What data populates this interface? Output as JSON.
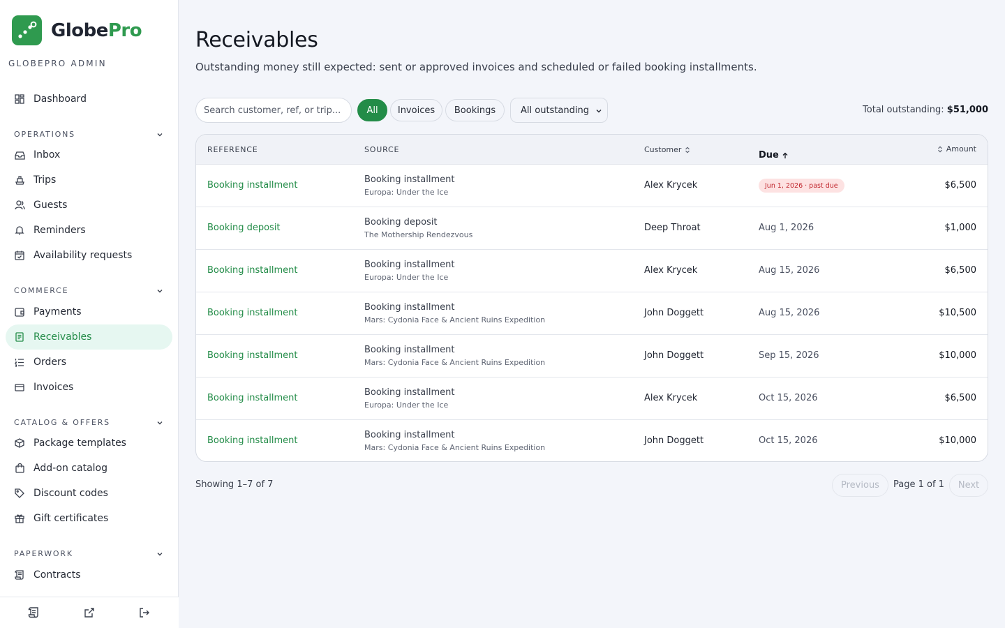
{
  "brand": {
    "name_main": "Globe",
    "name_accent": "Pro",
    "admin_label": "GLOBEPRO ADMIN",
    "color": "#2f9a4f"
  },
  "sidebar": {
    "dashboard": {
      "label": "Dashboard",
      "icon": "dashboard-icon"
    },
    "sections": {
      "operations": {
        "title": "OPERATIONS",
        "items": [
          {
            "label": "Inbox",
            "icon": "inbox-icon"
          },
          {
            "label": "Trips",
            "icon": "ship-icon"
          },
          {
            "label": "Guests",
            "icon": "users-icon"
          },
          {
            "label": "Reminders",
            "icon": "bell-icon"
          },
          {
            "label": "Availability requests",
            "icon": "calendar-check-icon"
          }
        ]
      },
      "commerce": {
        "title": "COMMERCE",
        "items": [
          {
            "label": "Payments",
            "icon": "wallet-icon"
          },
          {
            "label": "Receivables",
            "icon": "receipt-icon",
            "active": true
          },
          {
            "label": "Orders",
            "icon": "list-ordered-icon"
          },
          {
            "label": "Invoices",
            "icon": "credit-card-icon"
          }
        ]
      },
      "catalog": {
        "title": "CATALOG & OFFERS",
        "items": [
          {
            "label": "Package templates",
            "icon": "package-icon"
          },
          {
            "label": "Add-on catalog",
            "icon": "shopping-bag-icon"
          },
          {
            "label": "Discount codes",
            "icon": "tag-icon"
          },
          {
            "label": "Gift certificates",
            "icon": "gift-icon"
          }
        ]
      },
      "paperwork": {
        "title": "PAPERWORK",
        "items": [
          {
            "label": "Contracts",
            "icon": "scroll-icon"
          }
        ]
      }
    },
    "footer_icons": [
      "scroll-icon",
      "external-link-icon",
      "logout-icon"
    ]
  },
  "page": {
    "title": "Receivables",
    "subtitle": "Outstanding money still expected: sent or approved invoices and scheduled or failed booking installments."
  },
  "filters": {
    "search_placeholder": "Search customer, ref, or trip...",
    "chips": [
      {
        "label": "All",
        "active": true
      },
      {
        "label": "Invoices",
        "active": false
      },
      {
        "label": "Bookings",
        "active": false
      }
    ],
    "status_select": "All outstanding",
    "total_label": "Total outstanding:",
    "total_value": "$51,000"
  },
  "table": {
    "headers": {
      "reference": "REFERENCE",
      "source": "SOURCE",
      "customer": "Customer",
      "due": "Due",
      "amount": "Amount"
    },
    "rows": [
      {
        "reference": "Booking installment",
        "source_title": "Booking installment",
        "source_sub": "Europa: Under the Ice",
        "customer": "Alex Krycek",
        "due": "Jun 1, 2026 · past due",
        "past_due": true,
        "amount": "$6,500"
      },
      {
        "reference": "Booking deposit",
        "source_title": "Booking deposit",
        "source_sub": "The Mothership Rendezvous",
        "customer": "Deep Throat",
        "due": "Aug 1, 2026",
        "past_due": false,
        "amount": "$1,000"
      },
      {
        "reference": "Booking installment",
        "source_title": "Booking installment",
        "source_sub": "Europa: Under the Ice",
        "customer": "Alex Krycek",
        "due": "Aug 15, 2026",
        "past_due": false,
        "amount": "$6,500"
      },
      {
        "reference": "Booking installment",
        "source_title": "Booking installment",
        "source_sub": "Mars: Cydonia Face & Ancient Ruins Expedition",
        "customer": "John Doggett",
        "due": "Aug 15, 2026",
        "past_due": false,
        "amount": "$10,500"
      },
      {
        "reference": "Booking installment",
        "source_title": "Booking installment",
        "source_sub": "Mars: Cydonia Face & Ancient Ruins Expedition",
        "customer": "John Doggett",
        "due": "Sep 15, 2026",
        "past_due": false,
        "amount": "$10,000"
      },
      {
        "reference": "Booking installment",
        "source_title": "Booking installment",
        "source_sub": "Europa: Under the Ice",
        "customer": "Alex Krycek",
        "due": "Oct 15, 2026",
        "past_due": false,
        "amount": "$6,500"
      },
      {
        "reference": "Booking installment",
        "source_title": "Booking installment",
        "source_sub": "Mars: Cydonia Face & Ancient Ruins Expedition",
        "customer": "John Doggett",
        "due": "Oct 15, 2026",
        "past_due": false,
        "amount": "$10,000"
      }
    ]
  },
  "pagination": {
    "showing": "Showing 1–7 of 7",
    "previous": "Previous",
    "page_info": "Page 1 of 1",
    "next": "Next"
  },
  "colors": {
    "accent": "#238c48",
    "active_bg": "#e6f7f1",
    "past_due_bg": "#fde2e2",
    "past_due_text": "#c0262d"
  }
}
